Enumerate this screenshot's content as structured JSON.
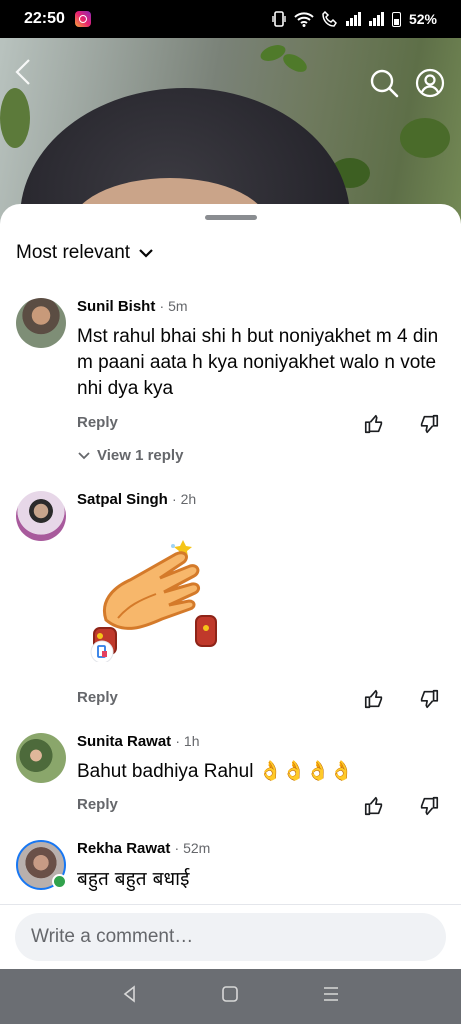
{
  "status_bar": {
    "time": "22:50",
    "battery": "52%",
    "icons": [
      "instagram-notification-icon",
      "vibrate-icon",
      "wifi-icon",
      "call-icon",
      "signal-icon",
      "signal-icon",
      "battery-icon"
    ]
  },
  "video": {
    "icons": [
      "back-arrow-icon",
      "search-icon",
      "profile-icon"
    ]
  },
  "sheet": {
    "sort_label": "Most relevant"
  },
  "comments": [
    {
      "author": "Sunil Bisht",
      "time": "· 5m",
      "text": "Mst rahul bhai shi h but noniyakhet m 4 din m paani aata h kya noniyakhet walo n vote nhi dya kya",
      "reply_label": "Reply",
      "view_replies": "View 1 reply"
    },
    {
      "author": "Satpal Singh",
      "time": "· 2h",
      "sticker": "clapping-hands-sticker",
      "reply_label": "Reply"
    },
    {
      "author": "Sunita Rawat",
      "time": "· 1h",
      "text": "Bahut badhiya Rahul 👌👌👌👌",
      "reply_label": "Reply"
    },
    {
      "author": "Rekha Rawat",
      "time": "· 52m",
      "text": "बहुत बहुत बधाई",
      "online": true
    }
  ],
  "composer": {
    "placeholder": "Write a comment…"
  },
  "system_nav": {
    "icons": [
      "nav-back-icon",
      "nav-home-icon",
      "nav-recents-icon"
    ]
  },
  "colors": {
    "secondary_text": "#65676b",
    "primary_text": "#050505",
    "online_dot": "#31a24c",
    "input_bg": "#f0f2f5"
  }
}
